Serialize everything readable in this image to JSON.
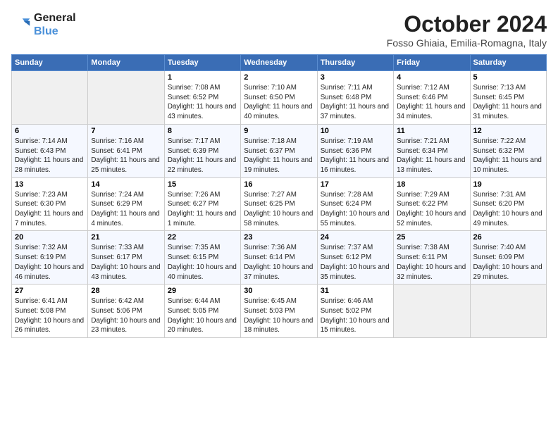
{
  "header": {
    "logo_line1": "General",
    "logo_line2": "Blue",
    "month": "October 2024",
    "location": "Fosso Ghiaia, Emilia-Romagna, Italy"
  },
  "weekdays": [
    "Sunday",
    "Monday",
    "Tuesday",
    "Wednesday",
    "Thursday",
    "Friday",
    "Saturday"
  ],
  "weeks": [
    [
      {
        "day": "",
        "info": ""
      },
      {
        "day": "",
        "info": ""
      },
      {
        "day": "1",
        "info": "Sunrise: 7:08 AM\nSunset: 6:52 PM\nDaylight: 11 hours and 43 minutes."
      },
      {
        "day": "2",
        "info": "Sunrise: 7:10 AM\nSunset: 6:50 PM\nDaylight: 11 hours and 40 minutes."
      },
      {
        "day": "3",
        "info": "Sunrise: 7:11 AM\nSunset: 6:48 PM\nDaylight: 11 hours and 37 minutes."
      },
      {
        "day": "4",
        "info": "Sunrise: 7:12 AM\nSunset: 6:46 PM\nDaylight: 11 hours and 34 minutes."
      },
      {
        "day": "5",
        "info": "Sunrise: 7:13 AM\nSunset: 6:45 PM\nDaylight: 11 hours and 31 minutes."
      }
    ],
    [
      {
        "day": "6",
        "info": "Sunrise: 7:14 AM\nSunset: 6:43 PM\nDaylight: 11 hours and 28 minutes."
      },
      {
        "day": "7",
        "info": "Sunrise: 7:16 AM\nSunset: 6:41 PM\nDaylight: 11 hours and 25 minutes."
      },
      {
        "day": "8",
        "info": "Sunrise: 7:17 AM\nSunset: 6:39 PM\nDaylight: 11 hours and 22 minutes."
      },
      {
        "day": "9",
        "info": "Sunrise: 7:18 AM\nSunset: 6:37 PM\nDaylight: 11 hours and 19 minutes."
      },
      {
        "day": "10",
        "info": "Sunrise: 7:19 AM\nSunset: 6:36 PM\nDaylight: 11 hours and 16 minutes."
      },
      {
        "day": "11",
        "info": "Sunrise: 7:21 AM\nSunset: 6:34 PM\nDaylight: 11 hours and 13 minutes."
      },
      {
        "day": "12",
        "info": "Sunrise: 7:22 AM\nSunset: 6:32 PM\nDaylight: 11 hours and 10 minutes."
      }
    ],
    [
      {
        "day": "13",
        "info": "Sunrise: 7:23 AM\nSunset: 6:30 PM\nDaylight: 11 hours and 7 minutes."
      },
      {
        "day": "14",
        "info": "Sunrise: 7:24 AM\nSunset: 6:29 PM\nDaylight: 11 hours and 4 minutes."
      },
      {
        "day": "15",
        "info": "Sunrise: 7:26 AM\nSunset: 6:27 PM\nDaylight: 11 hours and 1 minute."
      },
      {
        "day": "16",
        "info": "Sunrise: 7:27 AM\nSunset: 6:25 PM\nDaylight: 10 hours and 58 minutes."
      },
      {
        "day": "17",
        "info": "Sunrise: 7:28 AM\nSunset: 6:24 PM\nDaylight: 10 hours and 55 minutes."
      },
      {
        "day": "18",
        "info": "Sunrise: 7:29 AM\nSunset: 6:22 PM\nDaylight: 10 hours and 52 minutes."
      },
      {
        "day": "19",
        "info": "Sunrise: 7:31 AM\nSunset: 6:20 PM\nDaylight: 10 hours and 49 minutes."
      }
    ],
    [
      {
        "day": "20",
        "info": "Sunrise: 7:32 AM\nSunset: 6:19 PM\nDaylight: 10 hours and 46 minutes."
      },
      {
        "day": "21",
        "info": "Sunrise: 7:33 AM\nSunset: 6:17 PM\nDaylight: 10 hours and 43 minutes."
      },
      {
        "day": "22",
        "info": "Sunrise: 7:35 AM\nSunset: 6:15 PM\nDaylight: 10 hours and 40 minutes."
      },
      {
        "day": "23",
        "info": "Sunrise: 7:36 AM\nSunset: 6:14 PM\nDaylight: 10 hours and 37 minutes."
      },
      {
        "day": "24",
        "info": "Sunrise: 7:37 AM\nSunset: 6:12 PM\nDaylight: 10 hours and 35 minutes."
      },
      {
        "day": "25",
        "info": "Sunrise: 7:38 AM\nSunset: 6:11 PM\nDaylight: 10 hours and 32 minutes."
      },
      {
        "day": "26",
        "info": "Sunrise: 7:40 AM\nSunset: 6:09 PM\nDaylight: 10 hours and 29 minutes."
      }
    ],
    [
      {
        "day": "27",
        "info": "Sunrise: 6:41 AM\nSunset: 5:08 PM\nDaylight: 10 hours and 26 minutes."
      },
      {
        "day": "28",
        "info": "Sunrise: 6:42 AM\nSunset: 5:06 PM\nDaylight: 10 hours and 23 minutes."
      },
      {
        "day": "29",
        "info": "Sunrise: 6:44 AM\nSunset: 5:05 PM\nDaylight: 10 hours and 20 minutes."
      },
      {
        "day": "30",
        "info": "Sunrise: 6:45 AM\nSunset: 5:03 PM\nDaylight: 10 hours and 18 minutes."
      },
      {
        "day": "31",
        "info": "Sunrise: 6:46 AM\nSunset: 5:02 PM\nDaylight: 10 hours and 15 minutes."
      },
      {
        "day": "",
        "info": ""
      },
      {
        "day": "",
        "info": ""
      }
    ]
  ]
}
